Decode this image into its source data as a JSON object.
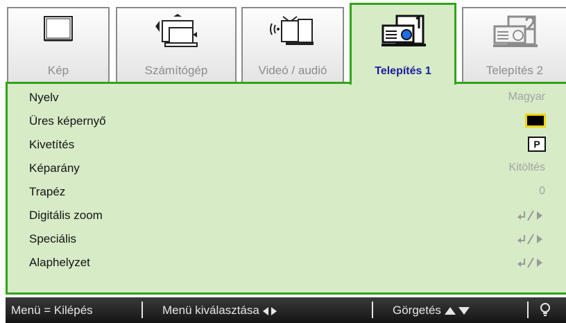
{
  "tabs": [
    {
      "label": "Kép",
      "icon": "monitor-icon",
      "active": false
    },
    {
      "label": "Számítógép",
      "icon": "laptop-icon",
      "active": false
    },
    {
      "label": "Videó / audió",
      "icon": "tv-signal-icon",
      "active": false
    },
    {
      "label": "Telepítés 1",
      "icon": "projector-1-icon",
      "active": true
    },
    {
      "label": "Telepítés 2",
      "icon": "projector-2-icon",
      "active": false
    }
  ],
  "menu": {
    "items": [
      {
        "label": "Nyelv",
        "value": "Magyar"
      },
      {
        "label": "Üres képernyő",
        "value": "",
        "value_icon": "black-screen-swatch"
      },
      {
        "label": "Kivetítés",
        "value": "P",
        "value_icon": "projection-mode-icon"
      },
      {
        "label": "Képarány",
        "value": "Kitöltés"
      },
      {
        "label": "Trapéz",
        "value": "0"
      },
      {
        "label": "Digitális zoom",
        "value": "",
        "value_icon": "enter-right-icon"
      },
      {
        "label": "Speciális",
        "value": "",
        "value_icon": "enter-right-icon"
      },
      {
        "label": "Alaphelyzet",
        "value": "",
        "value_icon": "enter-right-icon"
      }
    ]
  },
  "statusbar": {
    "exit": "Menü = Kilépés",
    "select": "Menü kiválasztása",
    "scroll": "Görgetés"
  },
  "colors": {
    "panel_bg": "#d6ebc6",
    "accent_green": "#33a21a",
    "active_tab_text": "#1c1c9c",
    "value_text": "#a3a3a3",
    "status_bg": "#1e1e1e"
  }
}
